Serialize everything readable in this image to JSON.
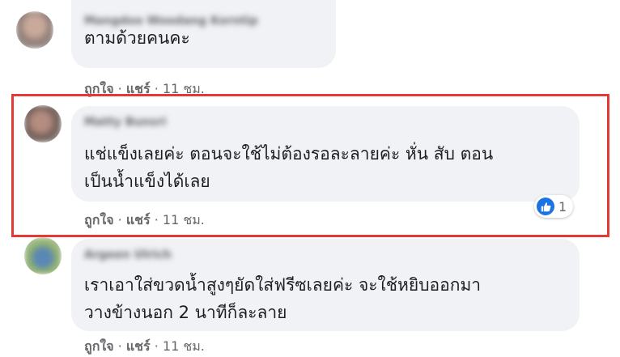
{
  "colors": {
    "highlight": "#e53935",
    "like_blue": "#1b74e4",
    "bubble_bg": "#f0f2f5",
    "meta_gray": "#65676b"
  },
  "comments": [
    {
      "author": "Mangdoo Woodang Korntip",
      "lines": [
        "ตามด้วยคนคะ"
      ],
      "like_label": "ถูกใจ",
      "reply_label": "แชร์",
      "sep": "·",
      "time": "11 ชม."
    },
    {
      "author": "Matty Bunsri",
      "lines": [
        "แช่แข็งเลยค่ะ ตอนจะใช้ไม่ต้องรอละลายค่ะ หั่น สับ ตอน",
        "เป็นน้ำแข็งได้เลย"
      ],
      "like_label": "ถูกใจ",
      "reply_label": "แชร์",
      "sep": "·",
      "time": "11 ชม.",
      "reaction_icon": "thumbs-up-icon",
      "reaction_count": "1"
    },
    {
      "author": "Argeen Ulrich",
      "lines": [
        "เราเอาใส่ขวดน้ำสูงๆยัดใส่ฟรีซเลยค่ะ จะใช้หยิบออกมา",
        "วางข้างนอก 2 นาทีก็ละลาย"
      ],
      "like_label": "ถูกใจ",
      "reply_label": "แชร์",
      "sep": "·",
      "time": "11 ชม."
    }
  ]
}
